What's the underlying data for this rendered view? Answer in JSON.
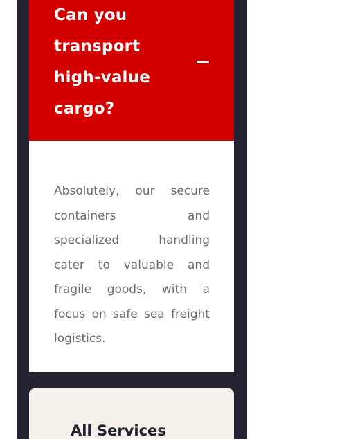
{
  "faq": {
    "question_lines": [
      "Can you",
      "transport",
      "high-value",
      "cargo?"
    ],
    "toggle_icon": "minus-icon",
    "answer_lines": [
      [
        "Absolutely,",
        "our",
        "secure"
      ],
      [
        "containers",
        "and"
      ],
      [
        "specialized",
        "handling"
      ],
      [
        "cater",
        "to",
        "valuable",
        "and"
      ],
      [
        "fragile",
        "goods,",
        "with",
        "a"
      ],
      [
        "focus",
        "on",
        "safe",
        "sea",
        "freight"
      ],
      [
        "logistics."
      ]
    ],
    "accent_color": "#d30000"
  },
  "services": {
    "title": "All Services"
  }
}
